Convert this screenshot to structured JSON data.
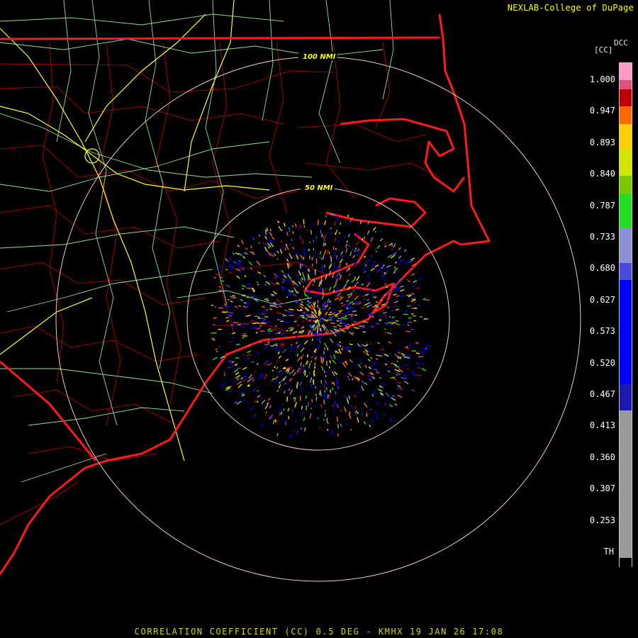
{
  "header": {
    "credit": "NEXLAB-College of DuPage"
  },
  "footer": {
    "caption": "CORRELATION COEFFICIENT (CC) 0.5 DEG - KMHX 19 JAN 26 17:08"
  },
  "radar": {
    "product_code": "DCC",
    "units": "[CC]",
    "range_rings": [
      "50 NMI",
      "100 NMI"
    ],
    "colors": {
      "state_borders": "#ff1a1a",
      "county_lines": "#cc0000",
      "highways": "#9fe89f",
      "interstates": "#ffff33",
      "range_rings": "#f0c8c8"
    }
  },
  "legend": {
    "labels": [
      "1.000",
      "0.947",
      "0.893",
      "0.840",
      "0.787",
      "0.733",
      "0.680",
      "0.627",
      "0.573",
      "0.520",
      "0.467",
      "0.413",
      "0.360",
      "0.307",
      "0.253",
      "TH"
    ],
    "scale_colors": [
      "#ff9bc6",
      "#e0507a",
      "#c00000",
      "#ff6a00",
      "#ffd000",
      "#d2e600",
      "#7cc800",
      "#22dd22",
      "#8f8fd8",
      "#4a4adf",
      "#0000ff",
      "#1a1ab0",
      "#9a9a9a",
      "#000000"
    ]
  }
}
